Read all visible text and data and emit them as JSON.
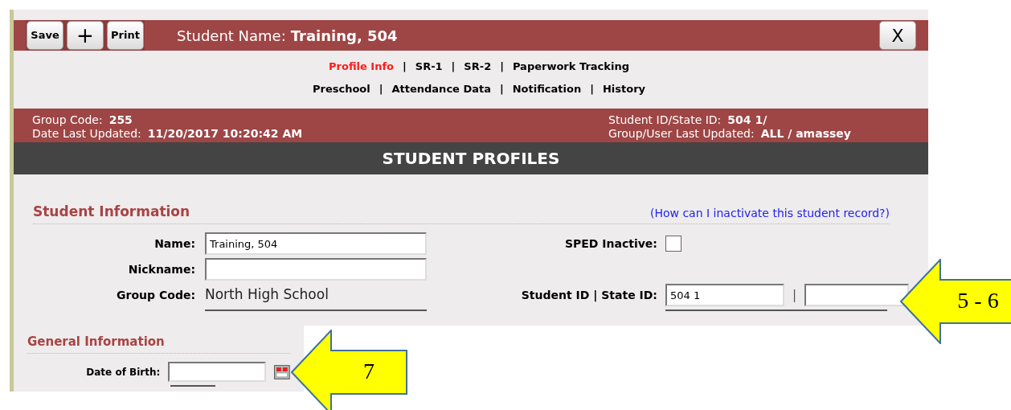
{
  "toolbar": {
    "buttons": [
      {
        "label": "Save",
        "kind": "text"
      },
      {
        "label": "+",
        "kind": "symbol"
      },
      {
        "label": "Print",
        "kind": "text"
      }
    ],
    "title_label": "Student Name:",
    "title_value": "Training, 504",
    "close": "X"
  },
  "nav": {
    "separator": "|",
    "first_line": [
      {
        "label": "Profile Info",
        "selected": true
      },
      {
        "label": "SR-1",
        "selected": false
      },
      {
        "label": "SR-2",
        "selected": false
      },
      {
        "label": "Paperwork Tracking",
        "selected": false
      }
    ],
    "second_line": [
      {
        "label": "Preschool",
        "selected": false
      },
      {
        "label": "Attendance Data",
        "selected": false
      },
      {
        "label": "Notification",
        "selected": false
      },
      {
        "label": "History",
        "selected": false
      }
    ]
  },
  "info": {
    "left": [
      {
        "label": "Group Code:",
        "value": "255"
      },
      {
        "label": "Date Last Updated:",
        "value": "11/20/2017 10:20:42 AM"
      }
    ],
    "right": [
      {
        "label": "Student ID/State ID:",
        "value": "504 1/"
      },
      {
        "label": "Group/User Last Updated:",
        "value": "ALL / amassey"
      }
    ]
  },
  "banner": "STUDENT PROFILES",
  "student_information": {
    "title": "Student Information",
    "help_link": "(How can I inactivate this student record?)",
    "left": [
      {
        "kind": "input",
        "label": "Name:",
        "value": "Training, 504"
      },
      {
        "kind": "input",
        "label": "Nickname:"
      },
      {
        "kind": "text",
        "label": "Group Code:",
        "value": "North High School"
      }
    ],
    "right": [
      {
        "kind": "checkbox",
        "label": "SPED Inactive:",
        "checked": false
      },
      {
        "kind": "pair",
        "label": "Student ID | State ID:",
        "value": "504 1",
        "separator": "|"
      }
    ]
  },
  "general_information": {
    "title": "General Information",
    "fields": [
      {
        "kind": "date",
        "label": "Date of Birth:"
      }
    ]
  },
  "callouts": [
    {
      "label": "5 - 6"
    },
    {
      "label": "7"
    }
  ]
}
